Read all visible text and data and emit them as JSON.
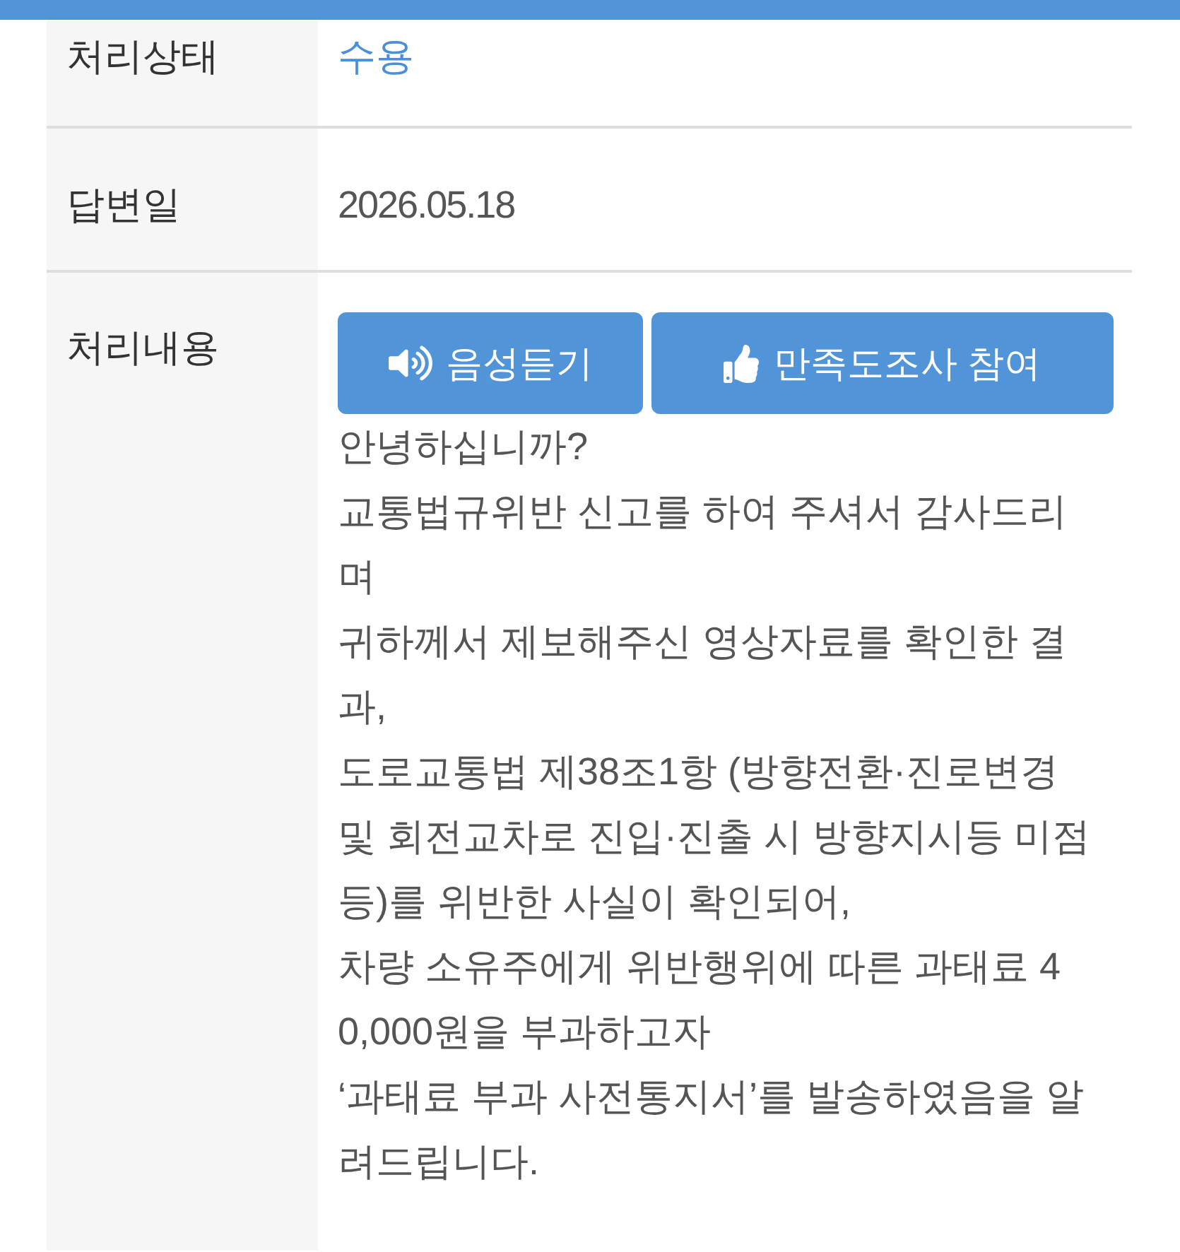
{
  "rows": [
    {
      "kind": "status",
      "label": "처리상태",
      "value": "수용"
    },
    {
      "kind": "text",
      "label": "답변일",
      "value": "2026.05.18"
    },
    {
      "kind": "reply",
      "label": "처리내용",
      "buttons": [
        {
          "kind": "audio",
          "label": "음성듣기"
        },
        {
          "kind": "survey",
          "label": "만족도조사 참여"
        }
      ],
      "message_lines": [
        "안녕하십니까?",
        "교통법규위반 신고를 하여 주셔서 감사드리",
        "며",
        "귀하께서 제보해주신 영상자료를 확인한 결",
        "과,",
        "도로교통법 제38조1항 (방향전환·진로변경",
        "및 회전교차로 진입·진출 시 방향지시등 미점",
        "등)를 위반한 사실이 확인되어,",
        "차량 소유주에게 위반행위에 따른 과태료 4",
        "0,000원을 부과하고자",
        "‘과태료 부과 사전통지서’를 발송하였음을 알",
        "려드립니다."
      ]
    }
  ]
}
